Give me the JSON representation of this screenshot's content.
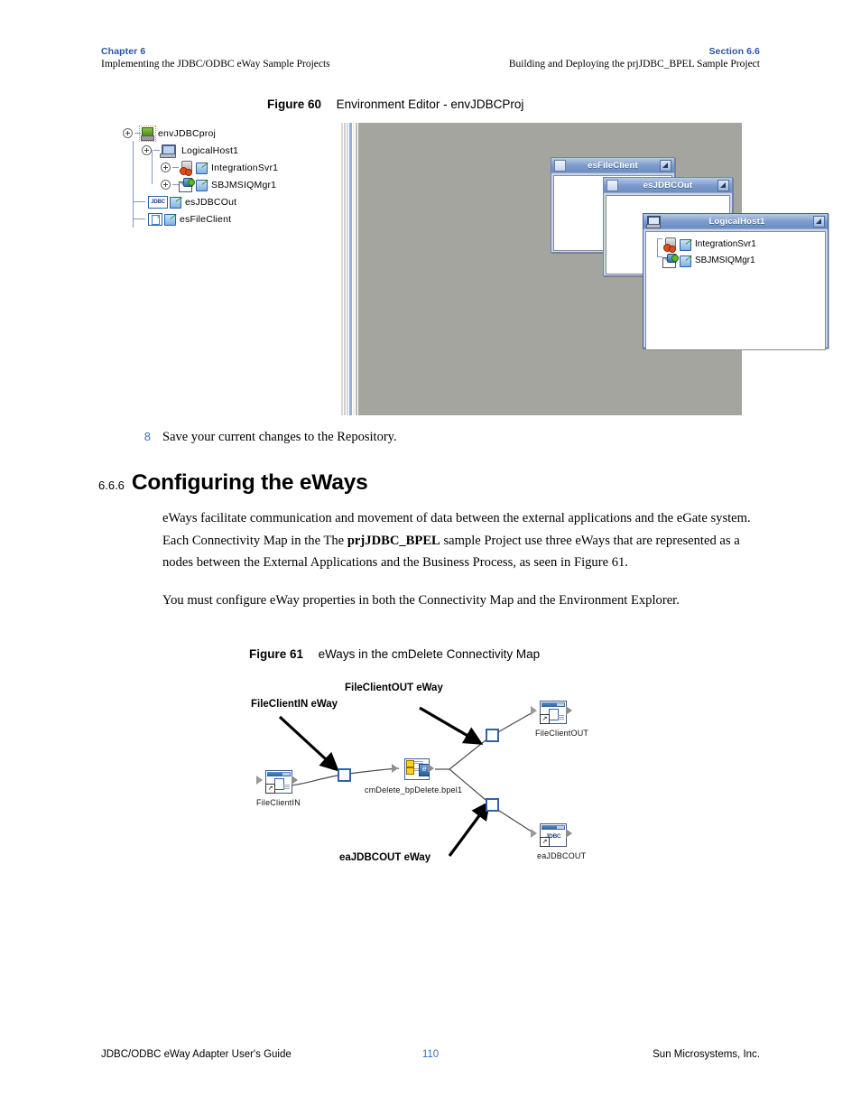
{
  "header": {
    "left_label": "Chapter 6",
    "left_sub": "Implementing the JDBC/ODBC eWay Sample Projects",
    "right_label": "Section 6.6",
    "right_sub": "Building and Deploying the prjJDBC_BPEL Sample Project"
  },
  "figure60": {
    "caption_number": "Figure 60",
    "caption_title": "Environment Editor - envJDBCProj",
    "tree": [
      {
        "label": "envJDBCproj",
        "icon": "environment-icon"
      },
      {
        "label": "LogicalHost1",
        "icon": "logical-host-icon"
      },
      {
        "label": "IntegrationSvr1",
        "icon": "integration-server-icon"
      },
      {
        "label": "SBJMSIQMgr1",
        "icon": "jms-iq-manager-icon"
      },
      {
        "label": "esJDBCOut",
        "icon": "jdbc-external-icon"
      },
      {
        "label": "esFileClient",
        "icon": "file-external-icon"
      }
    ],
    "windows": [
      {
        "title": "esFileClient",
        "rows": []
      },
      {
        "title": "esJDBCOut",
        "rows": []
      },
      {
        "title": "LogicalHost1",
        "rows": [
          "IntegrationSvr1",
          "SBJMSIQMgr1"
        ]
      }
    ],
    "canvas_color": "#a5a5a0"
  },
  "step": {
    "number": "8",
    "text": "Save your current changes to the Repository."
  },
  "section": {
    "number": "6.6.6",
    "title": "Configuring the eWays"
  },
  "paragraphs": {
    "p1_a": "eWays facilitate communication and movement of data between the external applications and the eGate system. Each Connectivity Map in the The ",
    "p1_bold": "prjJDBC_BPEL",
    "p1_b": " sample Project use three eWays that are represented as a nodes between the External Applications and the Business Process, as seen in Figure 61.",
    "p2": "You must configure eWay properties in both the Connectivity Map and the Environment Explorer."
  },
  "figure61": {
    "caption_number": "Figure 61",
    "caption_title": "eWays in the cmDelete Connectivity Map",
    "annotations": [
      {
        "label": "FileClientIN eWay"
      },
      {
        "label": "FileClientOUT eWay"
      },
      {
        "label": "eaJDBCOUT eWay"
      }
    ],
    "nodes": [
      {
        "label": "FileClientIN",
        "icon": "file-application-icon"
      },
      {
        "label": "cmDelete_bpDelete.bpel1",
        "icon": "business-process-icon"
      },
      {
        "label": "FileClientOUT",
        "icon": "file-application-icon"
      },
      {
        "label": "eaJDBCOUT",
        "icon": "jdbc-application-icon",
        "badge": "JDBC"
      }
    ]
  },
  "footer": {
    "left": "JDBC/ODBC eWay Adapter User's Guide",
    "page": "110",
    "right": "Sun Microsystems, Inc."
  },
  "colors": {
    "accent_blue": "#2b54a8",
    "page_number_blue": "#3a6ec0",
    "canvas_grey": "#a5a5a0",
    "titlebar_blue": "#7a9acb"
  }
}
